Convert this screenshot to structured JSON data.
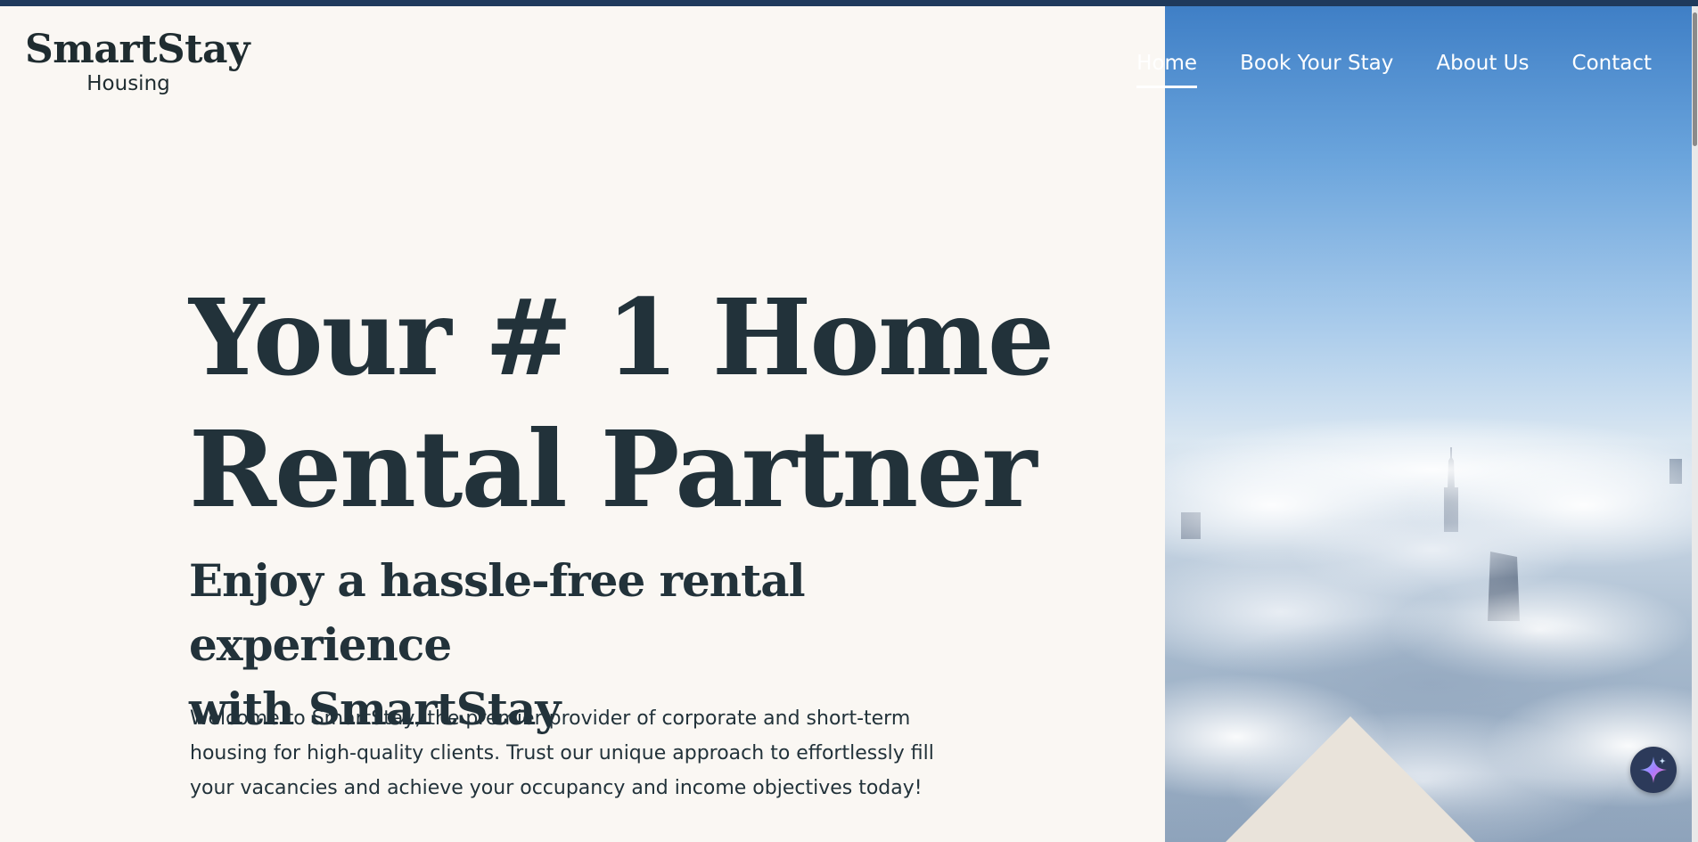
{
  "brand": {
    "name": "SmartStay",
    "tagline": "Housing"
  },
  "nav": {
    "items": [
      {
        "label": "Home",
        "active": true
      },
      {
        "label": "Book Your Stay",
        "active": false
      },
      {
        "label": "About Us",
        "active": false
      },
      {
        "label": "Contact",
        "active": false
      }
    ]
  },
  "hero": {
    "title_line1": "Your # 1 Home",
    "title_line2": "Rental Partner",
    "subtitle_line1": "Enjoy a hassle-free rental experience",
    "subtitle_line2": "with SmartStay",
    "body_line1": "Welcome to SmartStay, the premier provider of corporate and short-term",
    "body_line2": "housing for high-quality clients. Trust our unique approach to effortlessly fill",
    "body_line3": "your vacancies and achieve your occupancy and income objectives today!"
  },
  "colors": {
    "background": "#faf7f3",
    "text_dark": "#22323a",
    "top_bar": "#1f3a5c",
    "nav_text": "#ffffff",
    "triangle": "#e9e3da"
  },
  "icons": {
    "ai_assistant": "sparkle-icon",
    "logo_roof": "roof-chevron-icon"
  }
}
